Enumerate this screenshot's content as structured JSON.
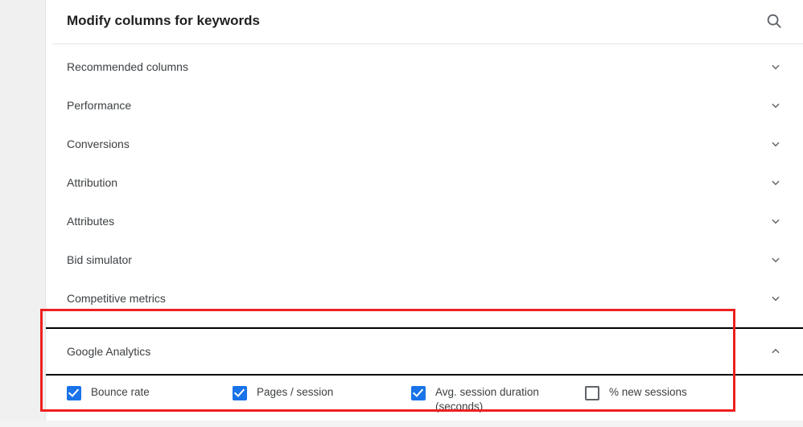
{
  "header": {
    "title": "Modify columns for keywords"
  },
  "sections": [
    {
      "label": "Recommended columns"
    },
    {
      "label": "Performance"
    },
    {
      "label": "Conversions"
    },
    {
      "label": "Attribution"
    },
    {
      "label": "Attributes"
    },
    {
      "label": "Bid simulator"
    },
    {
      "label": "Competitive metrics"
    }
  ],
  "ga_section": {
    "label": "Google Analytics",
    "options": [
      {
        "label": "Bounce rate",
        "checked": true
      },
      {
        "label": "Pages / session",
        "checked": true
      },
      {
        "label": "Avg. session duration (seconds)",
        "checked": true
      },
      {
        "label": "% new sessions",
        "checked": false
      }
    ]
  },
  "colors": {
    "accent": "#1a73e8",
    "highlight": "#ee2020"
  }
}
